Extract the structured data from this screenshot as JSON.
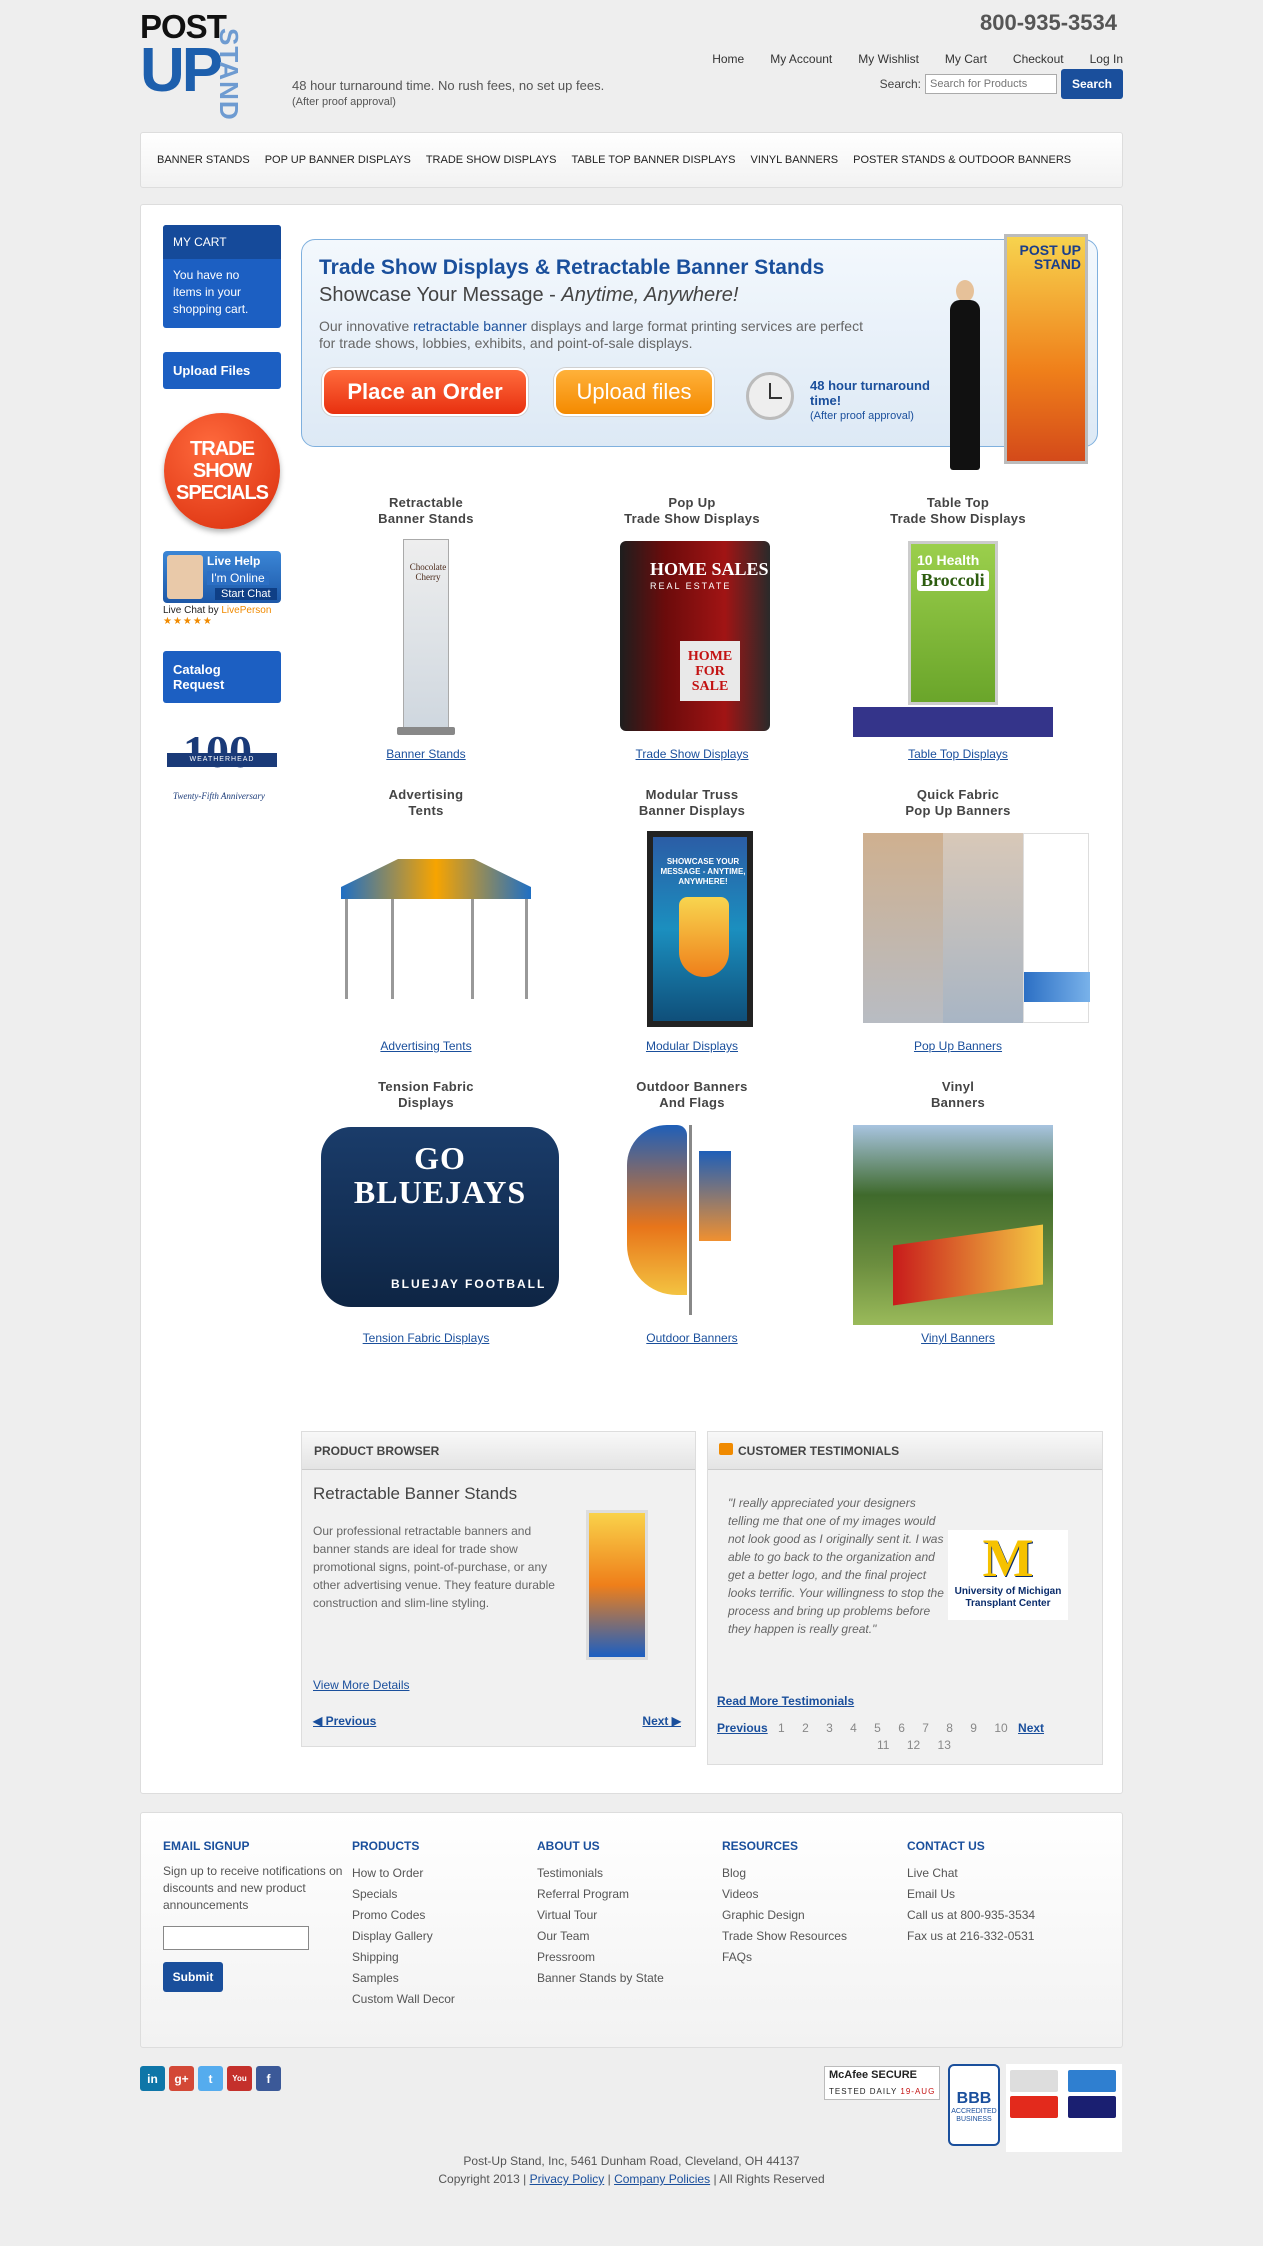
{
  "header": {
    "logo_post": "POST",
    "logo_up": "UP",
    "logo_stand": "STAND",
    "tagline": "48 hour turnaround time. No rush fees, no set up fees.",
    "tagline_sub": "(After proof approval)",
    "phone": "800-935-3534",
    "nav": [
      "Home",
      "My Account",
      "My Wishlist",
      "My Cart",
      "Checkout",
      "Log In"
    ],
    "search_label": "Search:",
    "search_placeholder": "Search for Products",
    "search_button": "Search"
  },
  "mainnav": [
    "BANNER STANDS",
    "POP UP BANNER DISPLAYS",
    "TRADE SHOW DISPLAYS",
    "TABLE TOP BANNER DISPLAYS",
    "VINYL BANNERS",
    "POSTER STANDS & OUTDOOR BANNERS"
  ],
  "sidebar": {
    "cart_title": "MY CART",
    "cart_text": "You have no items in your shopping cart.",
    "upload_files": "Upload Files",
    "specials": "TRADE SHOW SPECIALS",
    "livehelp_title": "Live Help",
    "livehelp_status": "I'm Online",
    "livehelp_start": "Start Chat",
    "livechat_by": "Live Chat by",
    "livechat_brand": "LivePerson",
    "stars": "★★★★★",
    "catalog": "Catalog Request",
    "anniv_num": "100",
    "anniv_band": "WEATHERHEAD",
    "anniv_cap": "Twenty-Fifth Anniversary"
  },
  "hero": {
    "title": "Trade Show Displays & Retractable Banner Stands",
    "subtitle": "Showcase Your Message -",
    "subtitle_em": "Anytime, Anywhere!",
    "desc_pre": "Our innovative",
    "desc_link": "retractable banner",
    "desc_post": "displays and large format printing services are perfect for trade shows, lobbies, exhibits, and point-of-sale displays.",
    "btn_order": "Place an Order",
    "btn_upload": "Upload files",
    "turnaround": "48 hour turnaround time!",
    "turnaround_sub": "(After proof approval)",
    "banner_text": "POST UP STAND"
  },
  "products": [
    {
      "title1": "Retractable",
      "title2": "Banner Stands",
      "caption": "Banner Stands"
    },
    {
      "title1": "Pop Up",
      "title2": "Trade Show Displays",
      "caption": "Trade Show Displays",
      "img_t1": "HOME SALES",
      "img_t2": "REAL ESTATE",
      "img_t3": "HOME FOR SALE"
    },
    {
      "title1": "Table Top",
      "title2": "Trade Show Displays",
      "caption": "Table Top Displays",
      "img_t1": "10 Health",
      "img_t2": "Broccoli"
    },
    {
      "title1": "Advertising",
      "title2": "Tents",
      "caption": "Advertising Tents"
    },
    {
      "title1": "Modular Truss",
      "title2": "Banner Displays",
      "caption": "Modular Displays",
      "img_t1": "SHOWCASE YOUR MESSAGE - ANYTIME, ANYWHERE!"
    },
    {
      "title1": "Quick Fabric",
      "title2": "Pop Up Banners",
      "caption": "Pop Up Banners"
    },
    {
      "title1": "Tension Fabric",
      "title2": "Displays",
      "caption": "Tension Fabric Displays",
      "img_t1": "GO BLUEJAYS",
      "img_t2": "BLUEJAY FOOTBALL"
    },
    {
      "title1": "Outdoor Banners",
      "title2": "And Flags",
      "caption": "Outdoor Banners"
    },
    {
      "title1": "Vinyl",
      "title2": "Banners",
      "caption": "Vinyl Banners"
    }
  ],
  "product_browser": {
    "header": "PRODUCT BROWSER",
    "title": "Retractable Banner Stands",
    "desc": "Our professional retractable banners and banner stands are ideal for trade show promotional signs, point-of-purchase, or any other advertising venue. They feature durable construction and slim-line styling.",
    "more": "View More Details",
    "prev": "Previous",
    "next": "Next"
  },
  "testimonials": {
    "header": "CUSTOMER TESTIMONIALS",
    "quote": "\"I really appreciated your designers telling me that one of my images would not look good as I originally sent it. I was able to go back to the organization and get a better logo, and the final project looks terrific. Your willingness to stop the process and bring up problems before they happen is really great.\"",
    "logo_m": "M",
    "logo_name": "University of Michigan Transplant Center",
    "read_more": "Read More Testimonials",
    "prev": "Previous",
    "next": "Next",
    "pages": [
      "1",
      "2",
      "3",
      "4",
      "5",
      "6",
      "7",
      "8",
      "9",
      "10",
      "11",
      "12",
      "13"
    ]
  },
  "footer": {
    "email": {
      "title": "EMAIL SIGNUP",
      "text": "Sign up to receive notifications on discounts and new product announcements",
      "submit": "Submit"
    },
    "products": {
      "title": "PRODUCTS",
      "items": [
        "How to Order",
        "Specials",
        "Promo Codes",
        "Display Gallery",
        "Shipping",
        "Samples",
        "Custom Wall Decor"
      ]
    },
    "about": {
      "title": "ABOUT US",
      "items": [
        "Testimonials",
        "Referral Program",
        "Virtual Tour",
        "Our Team",
        "Pressroom",
        "Banner Stands by State"
      ]
    },
    "resources": {
      "title": "RESOURCES",
      "items": [
        "Blog",
        "Videos",
        "Graphic Design",
        "Trade Show Resources",
        "FAQs"
      ]
    },
    "contact": {
      "title": "CONTACT US",
      "items": [
        "Live Chat",
        "Email Us",
        "Call us at 800-935-3534",
        "Fax us at 216-332-0531"
      ]
    }
  },
  "social": [
    {
      "icon": "linkedin-icon",
      "glyph": "in",
      "color": "#0e76a8"
    },
    {
      "icon": "google-plus-icon",
      "glyph": "g+",
      "color": "#d34836"
    },
    {
      "icon": "twitter-icon",
      "glyph": "t",
      "color": "#55acee"
    },
    {
      "icon": "youtube-icon",
      "glyph": "You",
      "color": "#c4302b"
    },
    {
      "icon": "facebook-icon",
      "glyph": "f",
      "color": "#3b5998"
    }
  ],
  "badges": {
    "mcafee": "McAfee SECURE",
    "mcafee_sub": "TESTED DAILY",
    "mcafee_date": "19-AUG",
    "bbb": "BBB",
    "bbb_sub": "ACCREDITED BUSINESS"
  },
  "copyright": {
    "address": "Post-Up Stand, Inc, 5461 Dunham Road, Cleveland, OH 44137",
    "copy": "Copyright 2013 |",
    "privacy": "Privacy Policy",
    "sep": "|",
    "company": "Company Policies",
    "rights": "| All Rights Reserved"
  }
}
